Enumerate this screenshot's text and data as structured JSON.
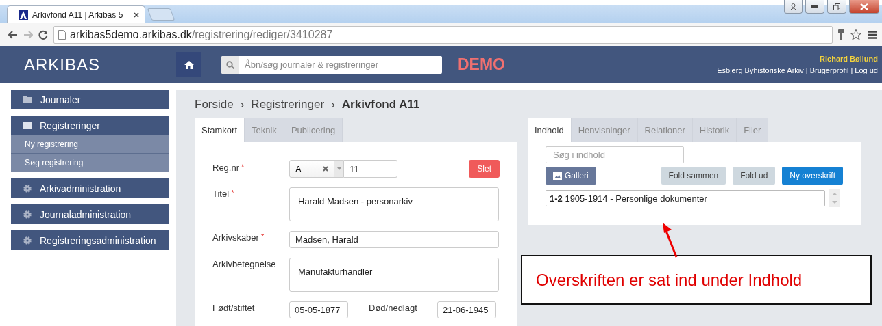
{
  "browser": {
    "tab_title": "Arkivfond A11 | Arkibas 5",
    "url_host": "arkibas5demo.arkibas.dk",
    "url_path": "/registrering/rediger/3410287"
  },
  "header": {
    "logo": "ARKIBAS",
    "search_placeholder": "Åbn/søg journaler & registreringer",
    "demo": "DEMO",
    "user_name": "Richard Bøllund",
    "organisation": "Esbjerg Byhistoriske Arkiv",
    "links": [
      {
        "separator": "|",
        "label": "Brugerprofil"
      },
      {
        "separator": "|",
        "label": "Log ud"
      }
    ]
  },
  "sidebar": {
    "items": [
      {
        "label": "Journaler",
        "kind": "folder"
      },
      {
        "label": "Registreringer",
        "kind": "archive",
        "children": [
          {
            "label": "Ny registrering"
          },
          {
            "label": "Søg registrering"
          }
        ]
      },
      {
        "label": "Arkivadministration",
        "kind": "gear"
      },
      {
        "label": "Journaladministration",
        "kind": "gear"
      },
      {
        "label": "Registreringsadministration",
        "kind": "gear"
      }
    ]
  },
  "breadcrumb": [
    {
      "label": "Forside",
      "link": true
    },
    {
      "separator": "›",
      "label": "Registreringer",
      "link": true
    },
    {
      "separator": "›",
      "label": "Arkivfond A11",
      "link": false
    }
  ],
  "left_panel": {
    "tabs": [
      {
        "label": "Stamkort",
        "selected": true
      },
      {
        "label": "Teknik",
        "selected": false
      },
      {
        "label": "Publicering",
        "selected": false
      }
    ],
    "delete_button": "Slet",
    "fields": [
      {
        "label": "Reg.nr",
        "mark": "*",
        "kind": "regnr",
        "prefix": "A",
        "value": "11"
      },
      {
        "label": "Titel",
        "mark": "*",
        "kind": "textarea",
        "value": "Harald Madsen - personarkiv"
      },
      {
        "label": "Arkivskaber",
        "mark": "*",
        "kind": "input",
        "value": "Madsen, Harald"
      },
      {
        "label": "Arkivbetegnelse",
        "kind": "textarea",
        "value": "Manufakturhandler"
      }
    ],
    "dates": [
      {
        "label": "Født/stiftet",
        "value": "05-05-1877"
      },
      {
        "label": "Død/nedlagt",
        "value": "21-06-1945"
      }
    ]
  },
  "right_panel": {
    "tabs": [
      {
        "label": "Indhold",
        "selected": true
      },
      {
        "label": "Henvisninger",
        "selected": false
      },
      {
        "label": "Relationer",
        "selected": false
      },
      {
        "label": "Historik",
        "selected": false
      },
      {
        "label": "Filer",
        "selected": false
      }
    ],
    "search_placeholder": "Søg i indhold",
    "buttons": [
      {
        "label": "Galleri",
        "kind": "gallery"
      },
      {
        "label": "Fold sammen",
        "kind": "plain"
      },
      {
        "label": "Fold ud",
        "kind": "plain"
      },
      {
        "label": "Ny overskrift",
        "kind": "primary"
      }
    ],
    "entries": [
      "**1-2** 1905-1914 - Personlige dokumenter"
    ]
  },
  "annotation": "Overskriften er sat ind under Indhold"
}
